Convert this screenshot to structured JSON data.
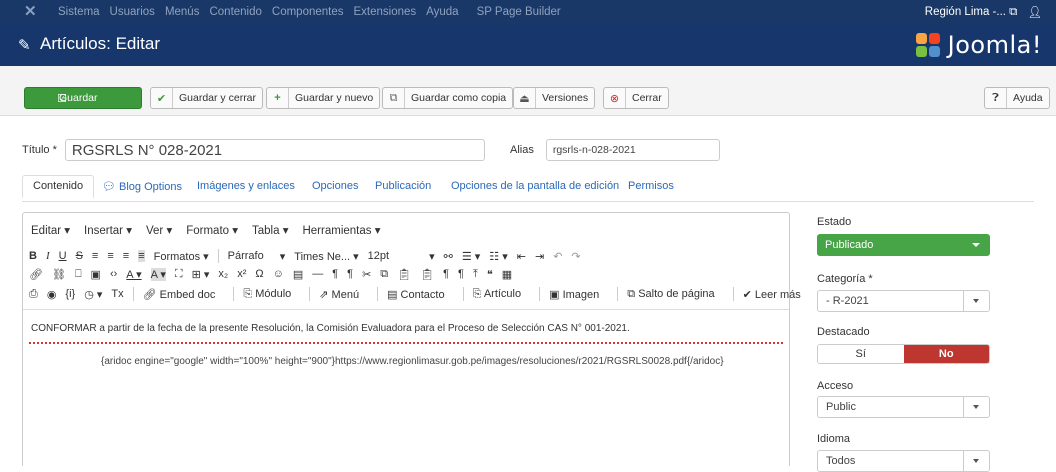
{
  "topbar": {
    "menu": [
      "Sistema",
      "Usuarios",
      "Menús",
      "Contenido",
      "Componentes",
      "Extensiones",
      "Ayuda",
      "SP Page Builder"
    ],
    "site_name": "Región Lima -...",
    "user_icon": "user-icon"
  },
  "header": {
    "title": "Artículos: Editar",
    "brand": "Joomla!"
  },
  "toolbar": {
    "save": "Guardar",
    "save_close": "Guardar y cerrar",
    "save_new": "Guardar y nuevo",
    "save_copy": "Guardar como copia",
    "versions": "Versiones",
    "close": "Cerrar",
    "help": "Ayuda"
  },
  "form": {
    "title_label": "Título *",
    "title_value": "RGSRLS N° 028-2021",
    "alias_label": "Alias",
    "alias_value": "rgsrls-n-028-2021"
  },
  "tabs": [
    "Contenido",
    "Blog Options",
    "Imágenes y enlaces",
    "Opciones",
    "Publicación",
    "Opciones de la pantalla de edición",
    "Permisos"
  ],
  "editor": {
    "menubar": [
      "Editar ▾",
      "Insertar ▾",
      "Ver ▾",
      "Formato ▾",
      "Tabla ▾",
      "Herramientas ▾"
    ],
    "formats": "Formatos ▾",
    "paragraph": "Párrafo",
    "font": "Times Ne... ▾",
    "size": "12pt",
    "buttons": [
      "Embed doc",
      "Módulo",
      "Menú",
      "Contacto",
      "Artículo",
      "Imagen",
      "Salto de página",
      "Leer más"
    ],
    "paragraph1": "CONFORMAR a partir de la fecha de la presente Resolución, la Comisión Evaluadora para el Proceso de Selección CAS N° 001-2021.",
    "paragraph2": "{aridoc engine=\"google\" width=\"100%\" height=\"900\"}https://www.regionlimasur.gob.pe/images/resoluciones/r2021/RGSRLS0028.pdf{/aridoc}"
  },
  "sidebar": {
    "status_label": "Estado",
    "status_value": "Publicado",
    "category_label": "Categoría *",
    "category_value": "- R-2021",
    "featured_label": "Destacado",
    "featured_yes": "Sí",
    "featured_no": "No",
    "access_label": "Acceso",
    "access_value": "Public",
    "language_label": "Idioma",
    "language_value": "Todos"
  },
  "colors": {
    "topbar": "#1a3867",
    "save": "#3c9a3c",
    "published": "#47a447",
    "no": "#bd362f"
  }
}
